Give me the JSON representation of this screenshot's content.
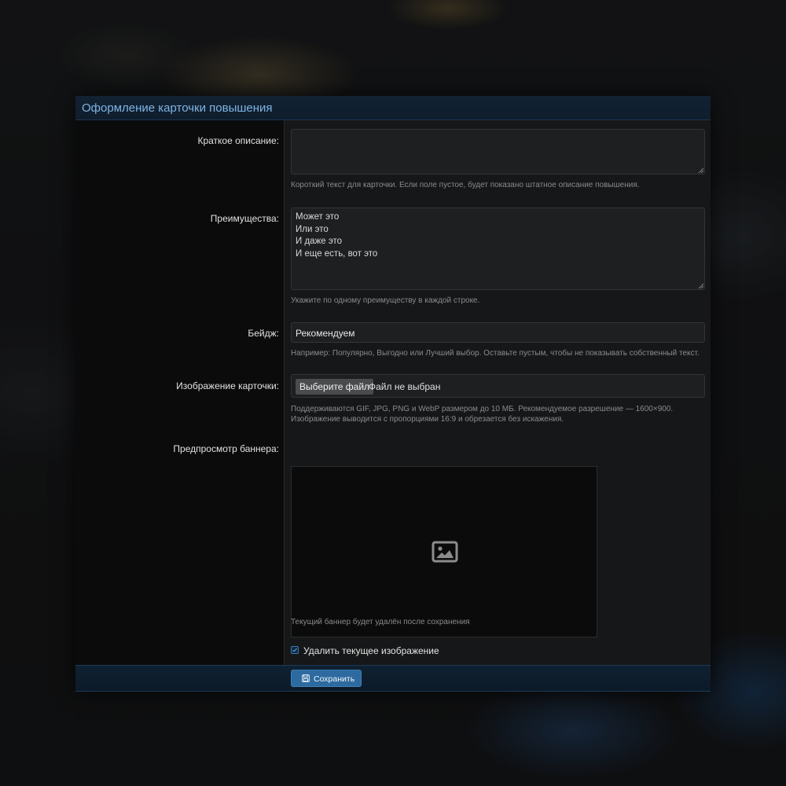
{
  "dialog": {
    "title": "Оформление карточки повышения"
  },
  "form": {
    "short_description": {
      "label": "Краткое описание:",
      "value": "",
      "hint": "Короткий текст для карточки. Если поле пустое, будет показано штатное описание повышения."
    },
    "advantages": {
      "label": "Преимущества:",
      "lines": [
        "Может это",
        "Или это",
        "И даже это",
        "И еще есть, вот это"
      ],
      "hint": "Укажите по одному преимуществу в каждой строке."
    },
    "badge": {
      "label": "Бейдж:",
      "value": "Рекомендуем",
      "hint": "Например: Популярно, Выгодно или Лучший выбор. Оставьте пустым, чтобы не показывать собственный текст."
    },
    "card_image": {
      "label": "Изображение карточки:",
      "button_label": "Выберите файл",
      "status": "Файл не выбран",
      "hint_line1": "Поддерживаются GIF, JPG, PNG и WebP размером до 10 МБ. Рекомендуемое разрешение — 1600×900.",
      "hint_line2": "Изображение выводится с пропорциями 16:9 и обрезается без искажения."
    },
    "banner_preview": {
      "label": "Предпросмотр баннера:",
      "icon": "image-placeholder-icon",
      "note": "Текущий баннер будет удалён после сохранения"
    },
    "delete_current": {
      "label": "Удалить текущее изображение",
      "checked": true
    }
  },
  "footer": {
    "save_label": "Сохранить",
    "save_icon": "save-icon"
  },
  "colors": {
    "accent": "#2d6aa0",
    "title": "#7fb4e4",
    "header_bg": "#122233",
    "panel_bg": "#161718",
    "label_bg": "#0b0b0c"
  }
}
